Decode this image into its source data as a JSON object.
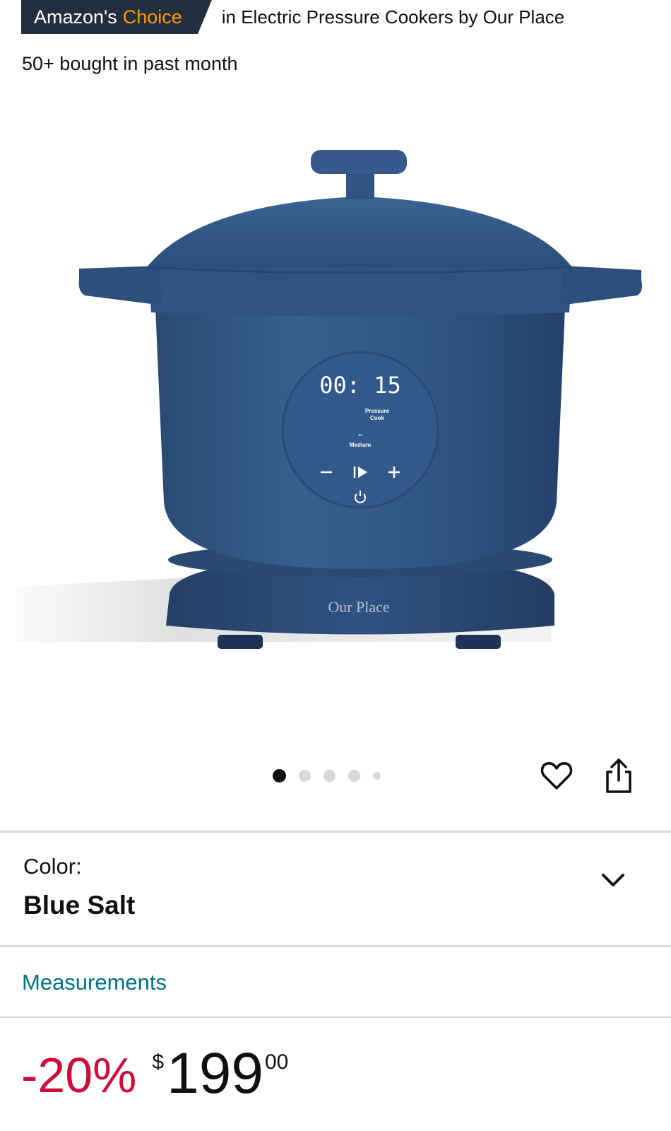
{
  "badge": {
    "amazons": "Amazon's",
    "choice": "Choice",
    "category_text": "in Electric Pressure Cookers by Our Place"
  },
  "social_proof": "50+ bought in past month",
  "image": {
    "display_time": "00: 15",
    "mode_line1": "Pressure",
    "mode_line2": "Cook",
    "level": "Medium",
    "brand": "Our Place",
    "pot_color": "#2f4f78"
  },
  "carousel": {
    "total": 5,
    "active_index": 0
  },
  "color": {
    "label": "Color:",
    "value": "Blue Salt"
  },
  "measurements_link": "Measurements",
  "price": {
    "discount": "-20%",
    "currency": "$",
    "whole": "199",
    "fraction": "00"
  },
  "colors": {
    "badge_bg": "#232f3e",
    "choice_orange": "#ff9900",
    "discount_red": "#cc0c39",
    "link_teal": "#007185"
  },
  "icons": [
    "heart-icon",
    "share-icon",
    "chevron-down-icon"
  ]
}
